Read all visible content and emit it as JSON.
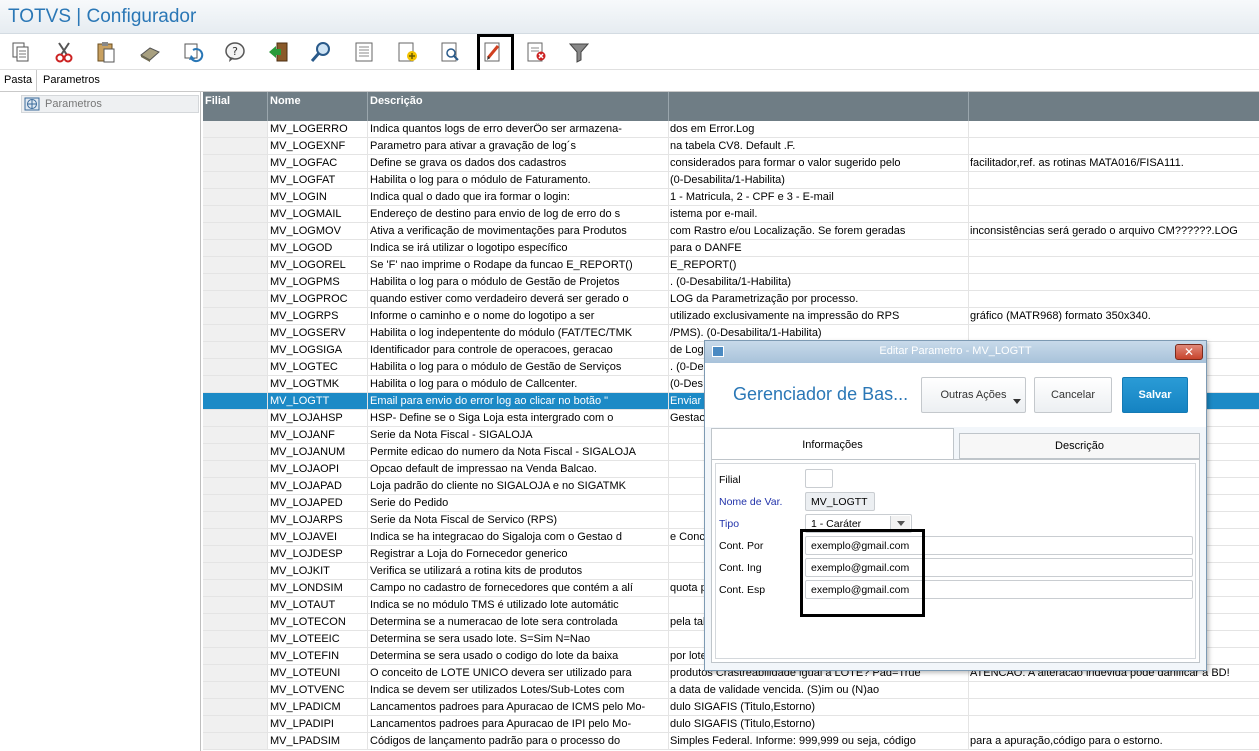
{
  "app": {
    "title": "TOTVS | Configurador"
  },
  "toolbar": {
    "buttons": [
      {
        "icon": "copy-icon"
      },
      {
        "icon": "cut-icon"
      },
      {
        "icon": "paste-icon"
      },
      {
        "icon": "eraser-icon"
      },
      {
        "icon": "refresh-icon"
      },
      {
        "icon": "help-icon"
      },
      {
        "icon": "exit-icon"
      },
      {
        "icon": "search-icon"
      },
      {
        "icon": "list-icon"
      },
      {
        "icon": "add-icon"
      },
      {
        "icon": "preview-icon"
      },
      {
        "icon": "edit-icon"
      },
      {
        "icon": "delete-icon"
      },
      {
        "icon": "filter-icon"
      }
    ]
  },
  "tabs": {
    "pasta": "Pasta",
    "parametros": "Parametros"
  },
  "tree": {
    "root": "Parametros"
  },
  "grid": {
    "columns": [
      "Filial",
      "Nome",
      "Descrição",
      "",
      ""
    ],
    "rows": [
      {
        "nome": "MV_LOGERRO",
        "d1": "Indica quantos logs de erro deverÔo ser armazena-",
        "d2": "dos em Error.Log",
        "d3": ""
      },
      {
        "nome": "MV_LOGEXNF",
        "d1": "Parametro para ativar a gravação de log´s",
        "d2": "na tabela CV8. Default .F.",
        "d3": ""
      },
      {
        "nome": "MV_LOGFAC",
        "d1": "Define se grava os dados dos cadastros",
        "d2": "considerados para formar o valor sugerido pelo",
        "d3": "facilitador,ref. as rotinas MATA016/FISA111."
      },
      {
        "nome": "MV_LOGFAT",
        "d1": "Habilita o log para o módulo de Faturamento.",
        "d2": "(0-Desabilita/1-Habilita)",
        "d3": ""
      },
      {
        "nome": "MV_LOGIN",
        "d1": "Indica qual o dado que ira formar o login:",
        "d2": "1 - Matricula, 2 - CPF e 3 - E-mail",
        "d3": ""
      },
      {
        "nome": "MV_LOGMAIL",
        "d1": "Endereço de destino para envio de log de erro do s",
        "d2": "istema por e-mail.",
        "d3": ""
      },
      {
        "nome": "MV_LOGMOV",
        "d1": "Ativa a verificação de movimentações para Produtos",
        "d2": "com Rastro  e/ou  Localização.  Se  forem  geradas",
        "d3": "inconsistências será gerado o arquivo CM??????.LOG"
      },
      {
        "nome": "MV_LOGOD",
        "d1": "Indica se irá utilizar o logotipo específico",
        "d2": "para o DANFE",
        "d3": ""
      },
      {
        "nome": "MV_LOGOREL",
        "d1": "Se 'F' nao imprime o Rodape da funcao E_REPORT()",
        "d2": "E_REPORT()",
        "d3": ""
      },
      {
        "nome": "MV_LOGPMS",
        "d1": "Habilita o log para o módulo de Gestão de Projetos",
        "d2": ". (0-Desabilita/1-Habilita)",
        "d3": ""
      },
      {
        "nome": "MV_LOGPROC",
        "d1": "quando estiver como verdadeiro deverá ser gerado o",
        "d2": "LOG da Parametrização por processo.",
        "d3": ""
      },
      {
        "nome": "MV_LOGRPS",
        "d1": "Informe o caminho e o nome do logotipo a ser",
        "d2": "utilizado exclusivamente na impressão do RPS",
        "d3": "gráfico (MATR968) formato 350x340."
      },
      {
        "nome": "MV_LOGSERV",
        "d1": "Habilita o log indepentente do módulo (FAT/TEC/TMK",
        "d2": "/PMS). (0-Desabilita/1-Habilita)",
        "d3": ""
      },
      {
        "nome": "MV_LOGSIGA",
        "d1": "Identificador para controle de operacoes, geracao",
        "d2": "de Log",
        "d3": ""
      },
      {
        "nome": "MV_LOGTEC",
        "d1": "Habilita o log para o módulo de Gestão de Serviços",
        "d2": ". (0-De",
        "d3": ""
      },
      {
        "nome": "MV_LOGTMK",
        "d1": "Habilita o log para o módulo de Callcenter.",
        "d2": "(0-Des",
        "d3": ""
      },
      {
        "nome": "MV_LOGTT",
        "d1": "Email para envio do error log ao clicar no botão \"",
        "d2": "Enviar",
        "d3": "",
        "selected": true
      },
      {
        "nome": "MV_LOJAHSP",
        "d1": "HSP- Define se o Siga Loja esta intergrado com o",
        "d2": "Gestao",
        "d3": ""
      },
      {
        "nome": "MV_LOJANF",
        "d1": "Serie da Nota Fiscal - SIGALOJA",
        "d2": "",
        "d3": ""
      },
      {
        "nome": "MV_LOJANUM",
        "d1": "Permite edicao do numero da Nota Fiscal - SIGALOJA",
        "d2": "",
        "d3": ""
      },
      {
        "nome": "MV_LOJAOPI",
        "d1": "Opcao default de impressao na Venda Balcao.",
        "d2": "",
        "d3": ""
      },
      {
        "nome": "MV_LOJAPAD",
        "d1": "Loja padrão do cliente no SIGALOJA e no SIGATMK",
        "d2": "",
        "d3": ""
      },
      {
        "nome": "MV_LOJAPED",
        "d1": "Serie do Pedido",
        "d2": "",
        "d3": ""
      },
      {
        "nome": "MV_LOJARPS",
        "d1": "Serie da Nota Fiscal de Servico (RPS)",
        "d2": "",
        "d3": ""
      },
      {
        "nome": "MV_LOJAVEI",
        "d1": "Indica se ha integracao do Sigaloja com o Gestao d",
        "d2": "e Conc",
        "d3": ""
      },
      {
        "nome": "MV_LOJDESP",
        "d1": "Registrar a Loja do Fornecedor generico",
        "d2": "",
        "d3": ""
      },
      {
        "nome": "MV_LOJKIT",
        "d1": "Verifica se utilizará a rotina kits de produtos",
        "d2": "",
        "d3": ""
      },
      {
        "nome": "MV_LONDSIM",
        "d1": "Campo no cadastro de fornecedores que contém a alí",
        "d2": "quota p",
        "d3": ""
      },
      {
        "nome": "MV_LOTAUT",
        "d1": "Indica se no módulo TMS é utilizado lote automátic",
        "d2": "",
        "d3": ""
      },
      {
        "nome": "MV_LOTECON",
        "d1": "Determina se a numeracao de lote sera controlada",
        "d2": "pela tab",
        "d3": ""
      },
      {
        "nome": "MV_LOTEEIC",
        "d1": "Determina se sera usado lote. S=Sim N=Nao",
        "d2": "",
        "d3": ""
      },
      {
        "nome": "MV_LOTEFIN",
        "d1": "Determina se sera usado o codigo do lote da baixa",
        "d2": "por lote",
        "d3": ""
      },
      {
        "nome": "MV_LOTEUNI",
        "d1": "O conceito de LOTE UNICO devera ser utilizado para",
        "d2": "produtos Crastreabilidade  igual a LOTE? Pad=True",
        "d3": "ATENCAO: A alteracao indevida pode danificar a BD!"
      },
      {
        "nome": "MV_LOTVENC",
        "d1": "Indica se devem ser utilizados Lotes/Sub-Lotes com",
        "d2": "a data de validade vencida. (S)im ou (N)ao",
        "d3": ""
      },
      {
        "nome": "MV_LPADICM",
        "d1": "Lancamentos padroes para Apuracao de ICMS pelo Mo-",
        "d2": "dulo SIGAFIS (Titulo,Estorno)",
        "d3": ""
      },
      {
        "nome": "MV_LPADIPI",
        "d1": "Lancamentos padroes para Apuracao de IPI pelo Mo-",
        "d2": "dulo SIGAFIS (Titulo,Estorno)",
        "d3": ""
      },
      {
        "nome": "MV_LPADSIM",
        "d1": "Códigos de lançamento padrão para o processo do",
        "d2": "Simples Federal. Informe: 999,999 ou seja, código",
        "d3": "para a apuração,código para o estorno."
      }
    ]
  },
  "dialog": {
    "title": "Editar Parametro - MV_LOGTT",
    "header": "Gerenciador de Bas...",
    "buttons": {
      "acoes": "Outras Ações",
      "cancel": "Cancelar",
      "save": "Salvar"
    },
    "tabs": {
      "info": "Informações",
      "desc": "Descrição"
    },
    "fields": {
      "filial_label": "Filial",
      "filial_value": "",
      "nome_label": "Nome de Var.",
      "nome_value": "MV_LOGTT",
      "tipo_label": "Tipo",
      "tipo_value": "1 - Caráter",
      "por_label": "Cont. Por",
      "por_value": "exemplo@gmail.com",
      "ing_label": "Cont. Ing",
      "ing_value": "exemplo@gmail.com",
      "esp_label": "Cont. Esp",
      "esp_value": "exemplo@gmail.com"
    }
  }
}
